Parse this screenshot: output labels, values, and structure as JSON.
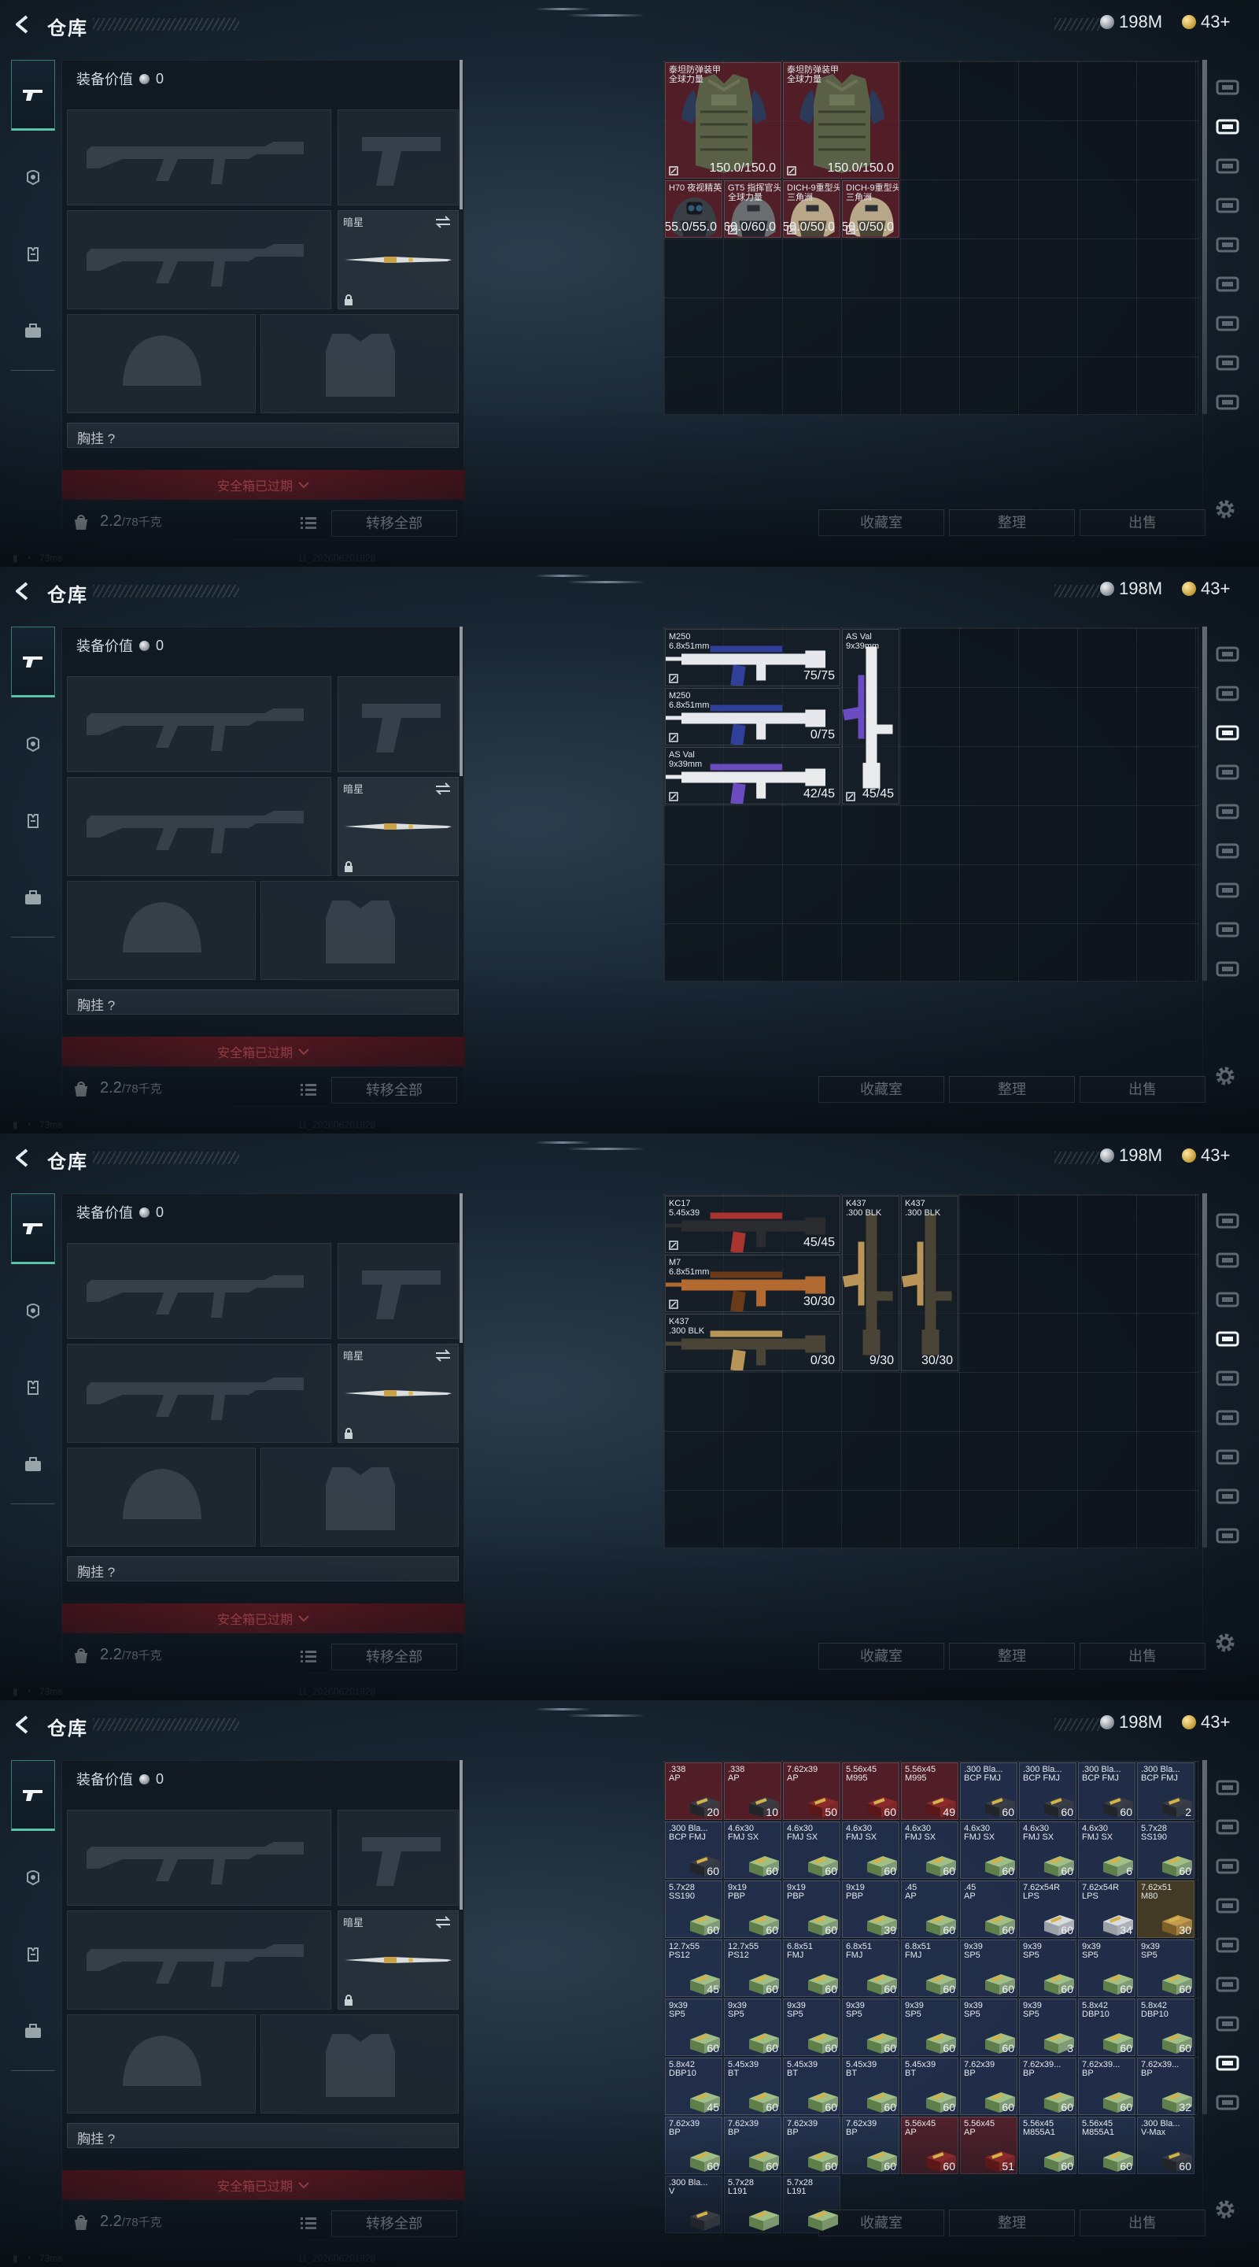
{
  "header": {
    "title": "仓库",
    "silver": "198M",
    "gold": "43+"
  },
  "equipment": {
    "value_label": "装备价值",
    "value": "0",
    "knife_label": "暗星",
    "chest_label": "胸挂 ?",
    "safebox_label": "安全箱已过期",
    "weight": "2.2",
    "weight_cap": "/78千克",
    "transfer_all": "转移全部"
  },
  "actions": {
    "favorites": "收藏室",
    "sort": "整理",
    "sell": "出售"
  },
  "status": {
    "ping": "73ms",
    "build": "11_202606201928"
  },
  "screens": [
    {
      "active_tab": 1,
      "items": [
        {
          "name": "泰坦防弹装甲\n全球力量",
          "count": "150.0/150.0",
          "c": 0,
          "r": 0,
          "w": 2,
          "h": 2,
          "bg": "red",
          "art": "armor",
          "ins": true
        },
        {
          "name": "泰坦防弹装甲\n全球力量",
          "count": "150.0/150.0",
          "c": 2,
          "r": 0,
          "w": 2,
          "h": 2,
          "bg": "red",
          "art": "armor",
          "ins": true
        },
        {
          "name": "H70 夜视精英头盔",
          "count": "55.0/55.0",
          "c": 0,
          "r": 2,
          "w": 1,
          "h": 1,
          "bg": "red",
          "art": "helmet-nv",
          "ins": false
        },
        {
          "name": "GT5 指挥官头盔\n全球力量",
          "count": "60.0/60.0",
          "c": 1,
          "r": 2,
          "w": 1,
          "h": 1,
          "bg": "red",
          "art": "helmet",
          "ins": true
        },
        {
          "name": "DICH-9重型头盔\n三角洲",
          "count": "50.0/50.0",
          "c": 2,
          "r": 2,
          "w": 1,
          "h": 1,
          "bg": "red",
          "art": "helmet-tan",
          "ins": true
        },
        {
          "name": "DICH-9重型头盔\n三角洲",
          "count": "50.0/50.0",
          "c": 3,
          "r": 2,
          "w": 1,
          "h": 1,
          "bg": "red",
          "art": "helmet-tan",
          "ins": true
        }
      ]
    },
    {
      "active_tab": 2,
      "items": [
        {
          "name": "M250\n6.8x51mm",
          "count": "75/75",
          "c": 0,
          "r": 0,
          "w": 3,
          "h": 1,
          "bg": "dark",
          "art": "rifle-blue",
          "ins": true
        },
        {
          "name": "M250\n6.8x51mm",
          "count": "0/75",
          "c": 0,
          "r": 1,
          "w": 3,
          "h": 1,
          "bg": "dark",
          "art": "rifle-blue",
          "ins": true
        },
        {
          "name": "AS Val\n9x39mm",
          "count": "42/45",
          "c": 0,
          "r": 2,
          "w": 3,
          "h": 1,
          "bg": "dark",
          "art": "rifle-white",
          "ins": true
        },
        {
          "name": "AS Val\n9x39mm",
          "count": "45/45",
          "c": 3,
          "r": 0,
          "w": 1,
          "h": 3,
          "bg": "dark",
          "art": "vrifle-white",
          "ins": true
        }
      ]
    },
    {
      "active_tab": 3,
      "items": [
        {
          "name": "KC17\n5.45x39",
          "count": "45/45",
          "c": 0,
          "r": 0,
          "w": 3,
          "h": 1,
          "bg": "dark",
          "art": "rifle-black",
          "ins": true
        },
        {
          "name": "M7\n6.8x51mm",
          "count": "30/30",
          "c": 0,
          "r": 1,
          "w": 3,
          "h": 1,
          "bg": "dark",
          "art": "rifle-copper",
          "ins": true
        },
        {
          "name": "K437\n.300 BLK",
          "count": "0/30",
          "c": 0,
          "r": 2,
          "w": 3,
          "h": 1,
          "bg": "dark",
          "art": "rifle-gold",
          "ins": false
        },
        {
          "name": "K437\n.300 BLK",
          "count": "9/30",
          "c": 3,
          "r": 0,
          "w": 1,
          "h": 3,
          "bg": "dark",
          "art": "vrifle-gold",
          "ins": false
        },
        {
          "name": "K437\n.300 BLK",
          "count": "30/30",
          "c": 4,
          "r": 0,
          "w": 1,
          "h": 3,
          "bg": "dark",
          "art": "vrifle-gold",
          "ins": false
        }
      ]
    },
    {
      "active_tab": 7,
      "ammo": [
        {
          "name": ".338\nAP",
          "count": "20",
          "bg": "red",
          "tone": "dark"
        },
        {
          "name": ".338\nAP",
          "count": "10",
          "bg": "red",
          "tone": "dark"
        },
        {
          "name": "7.62x39\nAP",
          "count": "50",
          "bg": "red",
          "tone": "red"
        },
        {
          "name": "5.56x45\nM995",
          "count": "60",
          "bg": "red",
          "tone": "red"
        },
        {
          "name": "5.56x45\nM995",
          "count": "49",
          "bg": "red",
          "tone": "red"
        },
        {
          "name": ".300 Bla...\nBCP FMJ",
          "count": "60",
          "bg": "blue",
          "tone": "dark"
        },
        {
          "name": ".300 Bla...\nBCP FMJ",
          "count": "60",
          "bg": "blue",
          "tone": "dark"
        },
        {
          "name": ".300 Bla...\nBCP FMJ",
          "count": "60",
          "bg": "blue",
          "tone": "dark"
        },
        {
          "name": ".300 Bla...\nBCP FMJ",
          "count": "2",
          "bg": "blue",
          "tone": "dark"
        },
        {
          "name": ".300 Bla...\nBCP FMJ",
          "count": "60",
          "bg": "blue",
          "tone": "dark"
        },
        {
          "name": "4.6x30\nFMJ SX",
          "count": "60",
          "bg": "blue",
          "tone": "green"
        },
        {
          "name": "4.6x30\nFMJ SX",
          "count": "60",
          "bg": "blue",
          "tone": "green"
        },
        {
          "name": "4.6x30\nFMJ SX",
          "count": "60",
          "bg": "blue",
          "tone": "green"
        },
        {
          "name": "4.6x30\nFMJ SX",
          "count": "60",
          "bg": "blue",
          "tone": "green"
        },
        {
          "name": "4.6x30\nFMJ SX",
          "count": "60",
          "bg": "blue",
          "tone": "green"
        },
        {
          "name": "4.6x30\nFMJ SX",
          "count": "60",
          "bg": "blue",
          "tone": "green"
        },
        {
          "name": "4.6x30\nFMJ SX",
          "count": "6",
          "bg": "blue",
          "tone": "green"
        },
        {
          "name": "5.7x28\nSS190",
          "count": "60",
          "bg": "blue",
          "tone": "green"
        },
        {
          "name": "5.7x28\nSS190",
          "count": "60",
          "bg": "blue",
          "tone": "green"
        },
        {
          "name": "9x19\nPBP",
          "count": "60",
          "bg": "blue",
          "tone": "green"
        },
        {
          "name": "9x19\nPBP",
          "count": "60",
          "bg": "blue",
          "tone": "green"
        },
        {
          "name": "9x19\nPBP",
          "count": "39",
          "bg": "blue",
          "tone": "green"
        },
        {
          "name": ".45\nAP",
          "count": "60",
          "bg": "blue",
          "tone": "green"
        },
        {
          "name": ".45\nAP",
          "count": "60",
          "bg": "blue",
          "tone": "green"
        },
        {
          "name": "7.62x54R\nLPS",
          "count": "60",
          "bg": "blue",
          "tone": "white"
        },
        {
          "name": "7.62x54R\nLPS",
          "count": "34",
          "bg": "blue",
          "tone": "white"
        },
        {
          "name": "7.62x51\nM80",
          "count": "30",
          "bg": "gold",
          "tone": "gold"
        },
        {
          "name": "12.7x55\nPS12",
          "count": "45",
          "bg": "blue",
          "tone": "green"
        },
        {
          "name": "12.7x55\nPS12",
          "count": "60",
          "bg": "blue",
          "tone": "green"
        },
        {
          "name": "6.8x51\nFMJ",
          "count": "60",
          "bg": "blue",
          "tone": "green"
        },
        {
          "name": "6.8x51\nFMJ",
          "count": "60",
          "bg": "blue",
          "tone": "green"
        },
        {
          "name": "6.8x51\nFMJ",
          "count": "60",
          "bg": "blue",
          "tone": "green"
        },
        {
          "name": "9x39\nSP5",
          "count": "60",
          "bg": "blue",
          "tone": "green"
        },
        {
          "name": "9x39\nSP5",
          "count": "60",
          "bg": "blue",
          "tone": "green"
        },
        {
          "name": "9x39\nSP5",
          "count": "60",
          "bg": "blue",
          "tone": "green"
        },
        {
          "name": "9x39\nSP5",
          "count": "60",
          "bg": "blue",
          "tone": "green"
        },
        {
          "name": "9x39\nSP5",
          "count": "60",
          "bg": "blue",
          "tone": "green"
        },
        {
          "name": "9x39\nSP5",
          "count": "60",
          "bg": "blue",
          "tone": "green"
        },
        {
          "name": "9x39\nSP5",
          "count": "60",
          "bg": "blue",
          "tone": "green"
        },
        {
          "name": "9x39\nSP5",
          "count": "60",
          "bg": "blue",
          "tone": "green"
        },
        {
          "name": "9x39\nSP5",
          "count": "60",
          "bg": "blue",
          "tone": "green"
        },
        {
          "name": "9x39\nSP5",
          "count": "60",
          "bg": "blue",
          "tone": "green"
        },
        {
          "name": "9x39\nSP5",
          "count": "3",
          "bg": "blue",
          "tone": "green"
        },
        {
          "name": "5.8x42\nDBP10",
          "count": "60",
          "bg": "blue",
          "tone": "green"
        },
        {
          "name": "5.8x42\nDBP10",
          "count": "60",
          "bg": "blue",
          "tone": "green"
        },
        {
          "name": "5.8x42\nDBP10",
          "count": "45",
          "bg": "blue",
          "tone": "green"
        },
        {
          "name": "5.45x39\nBT",
          "count": "60",
          "bg": "blue",
          "tone": "green"
        },
        {
          "name": "5.45x39\nBT",
          "count": "60",
          "bg": "blue",
          "tone": "green"
        },
        {
          "name": "5.45x39\nBT",
          "count": "60",
          "bg": "blue",
          "tone": "green"
        },
        {
          "name": "5.45x39\nBT",
          "count": "60",
          "bg": "blue",
          "tone": "green"
        },
        {
          "name": "7.62x39\nBP",
          "count": "60",
          "bg": "blue",
          "tone": "green"
        },
        {
          "name": "7.62x39...\nBP",
          "count": "60",
          "bg": "blue",
          "tone": "green"
        },
        {
          "name": "7.62x39...\nBP",
          "count": "60",
          "bg": "blue",
          "tone": "green"
        },
        {
          "name": "7.62x39...\nBP",
          "count": "32",
          "bg": "blue",
          "tone": "green"
        },
        {
          "name": "7.62x39\nBP",
          "count": "60",
          "bg": "blue",
          "tone": "green"
        },
        {
          "name": "7.62x39\nBP",
          "count": "60",
          "bg": "blue",
          "tone": "green"
        },
        {
          "name": "7.62x39\nBP",
          "count": "60",
          "bg": "blue",
          "tone": "green"
        },
        {
          "name": "7.62x39\nBP",
          "count": "60",
          "bg": "blue",
          "tone": "green"
        },
        {
          "name": "5.56x45\nAP",
          "count": "60",
          "bg": "red",
          "tone": "red"
        },
        {
          "name": "5.56x45\nAP",
          "count": "51",
          "bg": "red",
          "tone": "red"
        },
        {
          "name": "5.56x45\nM855A1",
          "count": "60",
          "bg": "blue",
          "tone": "green"
        },
        {
          "name": "5.56x45\nM855A1",
          "count": "60",
          "bg": "blue",
          "tone": "green"
        },
        {
          "name": ".300 Bla...\nV-Max",
          "count": "60",
          "bg": "blue",
          "tone": "dark"
        },
        {
          "name": ".300 Bla...\nV",
          "count": "",
          "bg": "blue",
          "tone": "dark"
        },
        {
          "name": "5.7x28\nL191",
          "count": "",
          "bg": "blue",
          "tone": "green"
        },
        {
          "name": "5.7x28\nL191",
          "count": "",
          "bg": "blue",
          "tone": "green"
        }
      ]
    }
  ]
}
